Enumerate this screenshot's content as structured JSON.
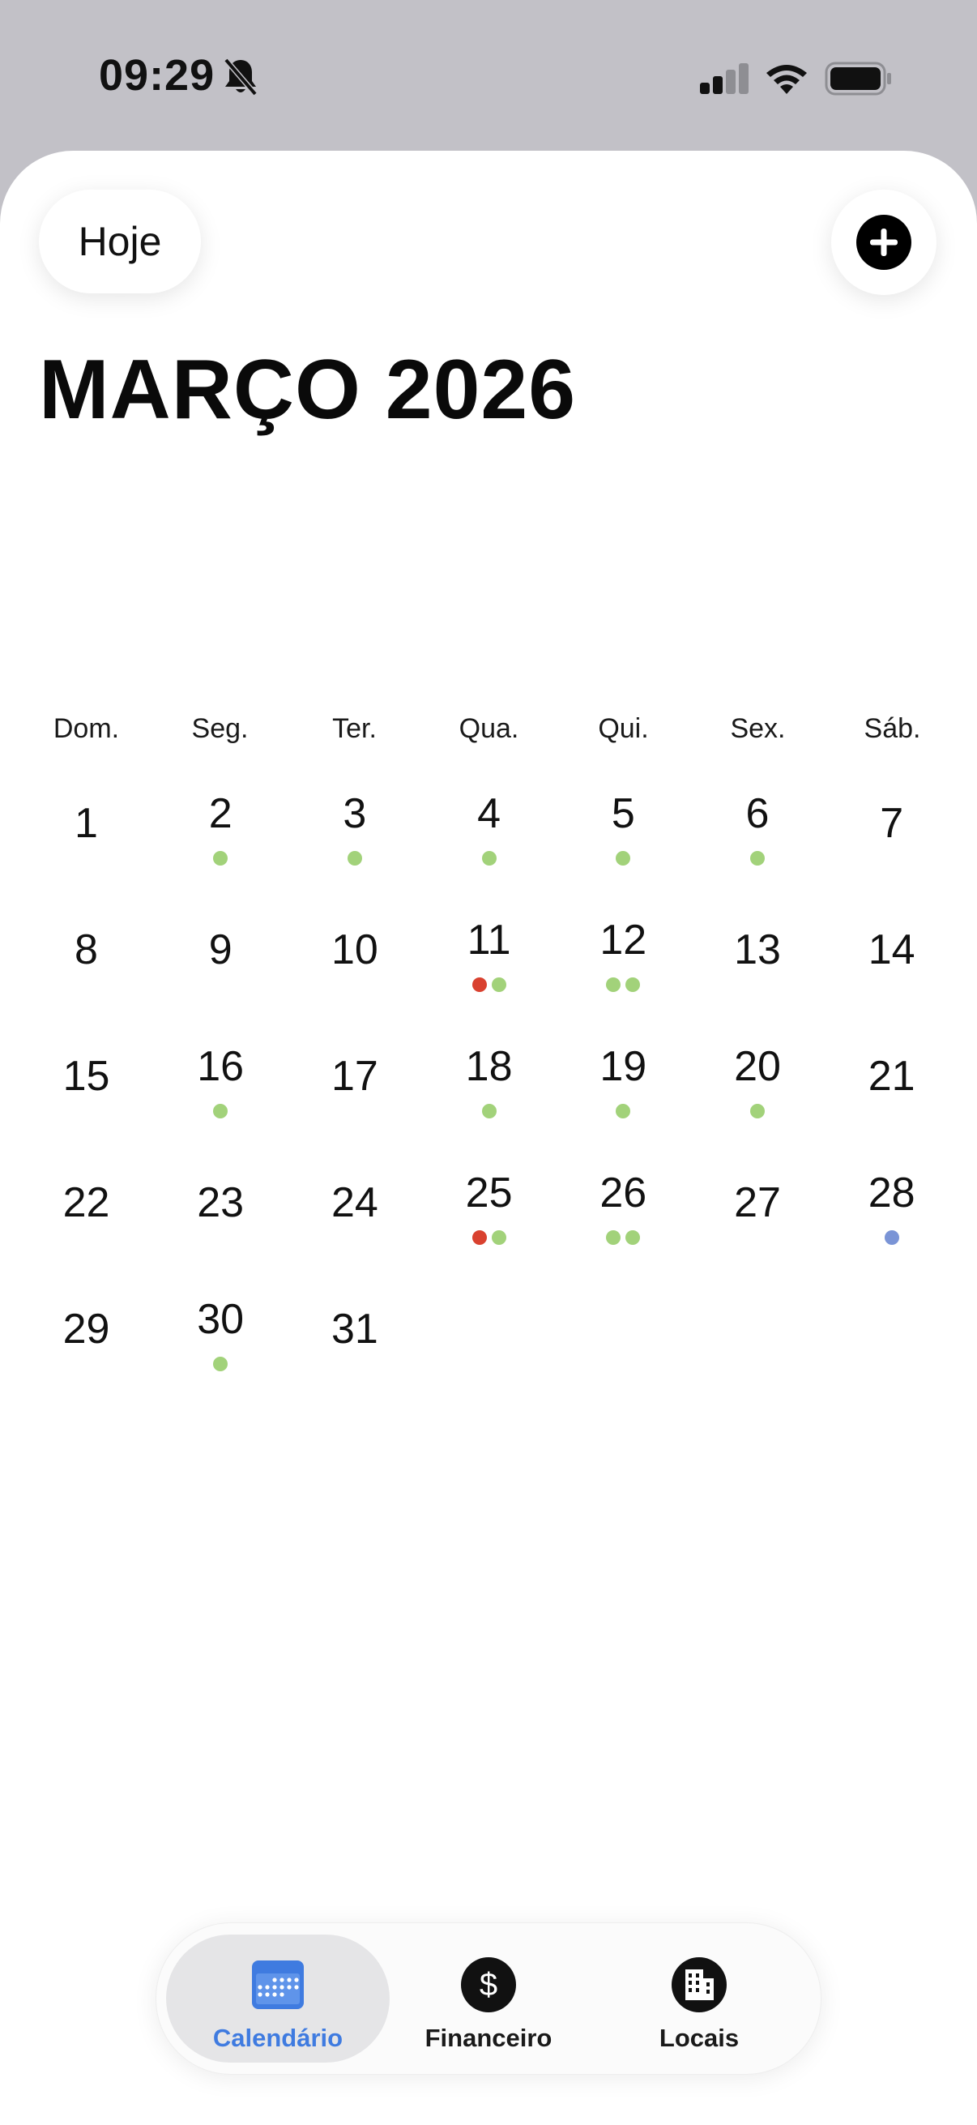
{
  "status_bar": {
    "time": "09:29"
  },
  "header": {
    "today_label": "Hoje"
  },
  "month_title": "MARÇO 2026",
  "weekdays": [
    "Dom.",
    "Seg.",
    "Ter.",
    "Qua.",
    "Qui.",
    "Sex.",
    "Sáb."
  ],
  "colors": {
    "green": "#a2d27a",
    "red": "#d9412f",
    "blue": "#7a94d6",
    "accent": "#3f7be0"
  },
  "days": [
    {
      "day": "1",
      "dots": []
    },
    {
      "day": "2",
      "dots": [
        "green"
      ]
    },
    {
      "day": "3",
      "dots": [
        "green"
      ]
    },
    {
      "day": "4",
      "dots": [
        "green"
      ]
    },
    {
      "day": "5",
      "dots": [
        "green"
      ]
    },
    {
      "day": "6",
      "dots": [
        "green"
      ]
    },
    {
      "day": "7",
      "dots": []
    },
    {
      "day": "8",
      "dots": []
    },
    {
      "day": "9",
      "dots": []
    },
    {
      "day": "10",
      "dots": []
    },
    {
      "day": "11",
      "dots": [
        "red",
        "green"
      ]
    },
    {
      "day": "12",
      "dots": [
        "green",
        "green"
      ]
    },
    {
      "day": "13",
      "dots": []
    },
    {
      "day": "14",
      "dots": []
    },
    {
      "day": "15",
      "dots": []
    },
    {
      "day": "16",
      "dots": [
        "green"
      ]
    },
    {
      "day": "17",
      "dots": []
    },
    {
      "day": "18",
      "dots": [
        "green"
      ]
    },
    {
      "day": "19",
      "dots": [
        "green"
      ]
    },
    {
      "day": "20",
      "dots": [
        "green"
      ]
    },
    {
      "day": "21",
      "dots": []
    },
    {
      "day": "22",
      "dots": []
    },
    {
      "day": "23",
      "dots": []
    },
    {
      "day": "24",
      "dots": []
    },
    {
      "day": "25",
      "dots": [
        "red",
        "green"
      ]
    },
    {
      "day": "26",
      "dots": [
        "green",
        "green"
      ]
    },
    {
      "day": "27",
      "dots": []
    },
    {
      "day": "28",
      "dots": [
        "blue"
      ]
    },
    {
      "day": "29",
      "dots": []
    },
    {
      "day": "30",
      "dots": [
        "green"
      ]
    },
    {
      "day": "31",
      "dots": []
    }
  ],
  "tabs": [
    {
      "label": "Calendário",
      "icon": "calendar-icon",
      "active": true
    },
    {
      "label": "Financeiro",
      "icon": "dollar-icon",
      "active": false
    },
    {
      "label": "Locais",
      "icon": "building-icon",
      "active": false
    }
  ]
}
